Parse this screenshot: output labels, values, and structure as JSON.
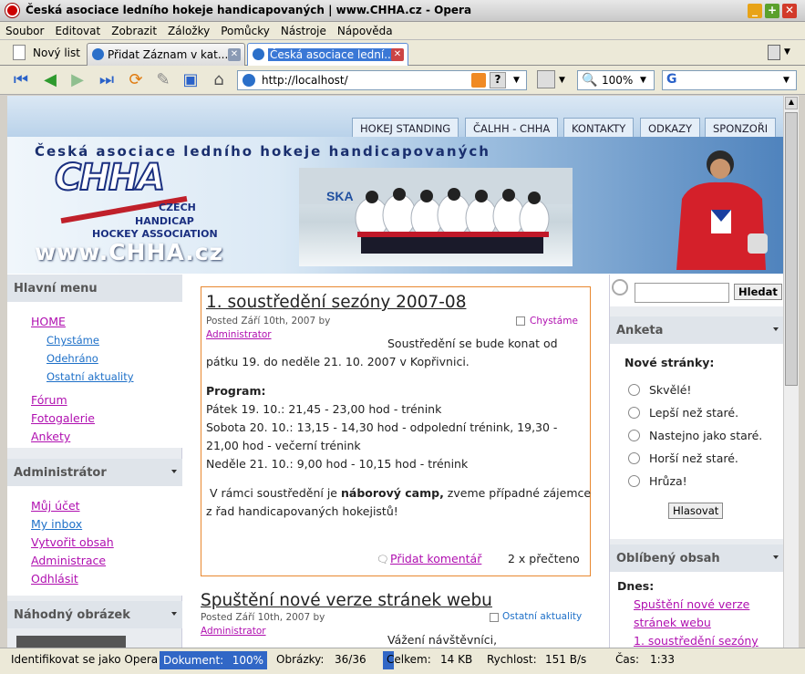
{
  "window": {
    "title": "Česká asociace ledního hokeje handicapovaných | www.CHHA.cz - Opera"
  },
  "menu": [
    "Soubor",
    "Editovat",
    "Zobrazit",
    "Záložky",
    "Pomůcky",
    "Nástroje",
    "Nápověda"
  ],
  "tabs": {
    "new_list": "Nový list",
    "tab1": "Přidat Záznam v kat...",
    "tab2": "Česká asociace lední..."
  },
  "toolbar": {
    "address": "http://localhost/",
    "zoom": "100%",
    "search_letter": "G"
  },
  "site": {
    "nav": [
      "HOKEJ STANDING",
      "ČALHH - CHHA",
      "KONTAKTY",
      "ODKAZY",
      "SPONZOŘI"
    ],
    "banner_title": "Česká asociace ledního hokeje handicapovaných",
    "logo_text": "CHHA",
    "logo_sub1": "CZECH",
    "logo_sub2": "HANDICAP",
    "logo_sub3": "HOCKEY ASSOCIATION",
    "url": "www.CHHA.cz",
    "rink_ad": "SKA"
  },
  "left": {
    "menu_title": "Hlavní menu",
    "home": "HOME",
    "sub": [
      "Chystáme",
      "Odehráno",
      "Ostatní aktuality"
    ],
    "links": [
      "Fórum",
      "Fotogalerie",
      "Ankety"
    ],
    "admin_title": "Administrátor",
    "admin_links": [
      "Můj účet",
      "My inbox",
      "Vytvořit obsah",
      "Administrace",
      "Odhlásit"
    ],
    "random_title": "Náhodný obrázek"
  },
  "posts": [
    {
      "title": "1. soustředění sezóny 2007-08",
      "meta": "Posted Září 10th, 2007 by",
      "author": "Administrator",
      "category": "Chystáme",
      "lines": [
        "Soustředění se bude konat od",
        "pátku 19.  do neděle 21. 10. 2007 v Kopřivnici.",
        "Program:",
        "Pátek 19. 10.: 21,45 - 23,00 hod - trénink",
        "Sobota 20. 10.: 13,15 - 14,30 hod - odpolední trénink, 19,30 -",
        "21,00 hod - večerní trénink",
        "Neděle 21. 10.: 9,00 hod - 10,15 hod - trénink"
      ],
      "camp_pre": " V rámci soustředění je ",
      "camp_bold": "náborový camp,",
      "camp_post": " zveme případné zájemce",
      "camp_line2": "z řad handicapovaných hokejistů!",
      "comment": "Přidat komentář",
      "reads": "2 x přečteno"
    },
    {
      "title": "Spuštění nové verze stránek webu",
      "meta": "Posted Září 10th, 2007 by",
      "author": "Administrator",
      "category": "Ostatní aktuality",
      "greeting": "Vážení návštěvníci,"
    }
  ],
  "right": {
    "search_button": "Hledat",
    "poll_title": "Anketa",
    "poll_question": "Nové stránky:",
    "options": [
      "Skvělé!",
      "Lepší než staré.",
      "Nastejno jako staré.",
      "Horší než staré.",
      "Hrůza!"
    ],
    "vote": "Hlasovat",
    "fav_title": "Oblíbený obsah",
    "today": "Dnes:",
    "fav1a": "Spuštění nové verze",
    "fav1b": "stránek webu",
    "fav2": "1. soustředění sezóny"
  },
  "status": {
    "identify": "Identifikovat se jako Opera",
    "document": "Dokument:",
    "doc_pct": "100%",
    "images_label": "Obrázky:",
    "images": "36/36",
    "total_label": "Celkem:",
    "total": "14 KB",
    "speed_label": "Rychlost:",
    "speed": "151 B/s",
    "time_label": "Čas:",
    "time": "1:33"
  }
}
